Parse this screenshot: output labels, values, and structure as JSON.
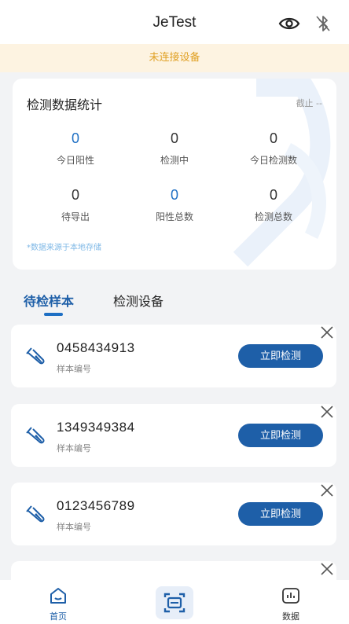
{
  "header": {
    "title": "JeTest"
  },
  "banner": {
    "text": "未连接设备"
  },
  "stats": {
    "title": "检测数据统计",
    "deadline": "截止 --",
    "items": [
      {
        "value": "0",
        "label": "今日阳性"
      },
      {
        "value": "0",
        "label": "检测中"
      },
      {
        "value": "0",
        "label": "今日检测数"
      },
      {
        "value": "0",
        "label": "待导出"
      },
      {
        "value": "0",
        "label": "阳性总数"
      },
      {
        "value": "0",
        "label": "检测总数"
      }
    ],
    "footnote": "*数据来源于本地存储"
  },
  "tabs": [
    {
      "label": "待检样本"
    },
    {
      "label": "检测设备"
    }
  ],
  "samples": [
    {
      "id": "0458434913",
      "caption": "样本编号",
      "button": "立即检测"
    },
    {
      "id": "1349349384",
      "caption": "样本编号",
      "button": "立即检测"
    },
    {
      "id": "0123456789",
      "caption": "样本编号",
      "button": "立即检测"
    }
  ],
  "nav": {
    "home": "首页",
    "data": "数据"
  },
  "colors": {
    "accent": "#1e5fa8",
    "banner_text": "#e0a024",
    "banner_bg": "#fdf3e1"
  }
}
